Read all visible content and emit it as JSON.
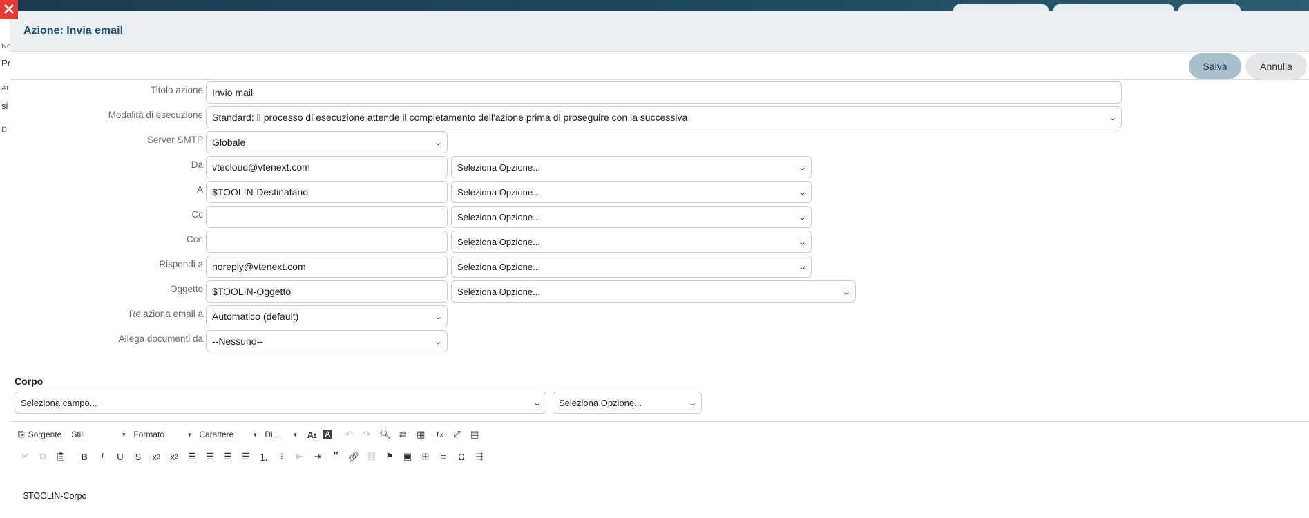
{
  "modal": {
    "title": "Azione: Invia email",
    "close_glyph": "✕"
  },
  "background": {
    "left_fragments": [
      "No",
      "Pr",
      "At",
      "si",
      "D"
    ]
  },
  "actions": {
    "save_label": "Salva",
    "cancel_label": "Annulla"
  },
  "form": {
    "titolo": {
      "label": "Titolo azione",
      "value": "Invio mail"
    },
    "modalita": {
      "label": "Modalità di esecuzione",
      "value": "Standard: il processo di esecuzione attende il completamento dell'azione prima di proseguire con la successiva"
    },
    "smtp": {
      "label": "Server SMTP",
      "value": "Globale"
    },
    "da": {
      "label": "Da",
      "value": "vtecloud@vtenext.com",
      "option": "Seleziona Opzione..."
    },
    "a": {
      "label": "A",
      "value": "$TOOLIN-Destinatario",
      "option": "Seleziona Opzione..."
    },
    "cc": {
      "label": "Cc",
      "value": "",
      "option": "Seleziona Opzione..."
    },
    "ccn": {
      "label": "Ccn",
      "value": "",
      "option": "Seleziona Opzione..."
    },
    "rispondi": {
      "label": "Rispondi a",
      "value": "noreply@vtenext.com",
      "option": "Seleziona Opzione..."
    },
    "oggetto": {
      "label": "Oggetto",
      "value": "$TOOLIN-Oggetto",
      "option": "Seleziona Opzione..."
    },
    "relaziona": {
      "label": "Relaziona email a",
      "value": "Automatico (default)"
    },
    "allega": {
      "label": "Allega documenti da",
      "value": "--Nessuno--"
    }
  },
  "corpo": {
    "label": "Corpo",
    "field_select": "Seleziona campo...",
    "option_select": "Seleziona Opzione..."
  },
  "editor": {
    "source_label": "Sorgente",
    "styles_label": "Stili",
    "format_label": "Formato",
    "font_label": "Carattere",
    "size_label": "Di...",
    "content": "$TOOLIN-Corpo"
  }
}
